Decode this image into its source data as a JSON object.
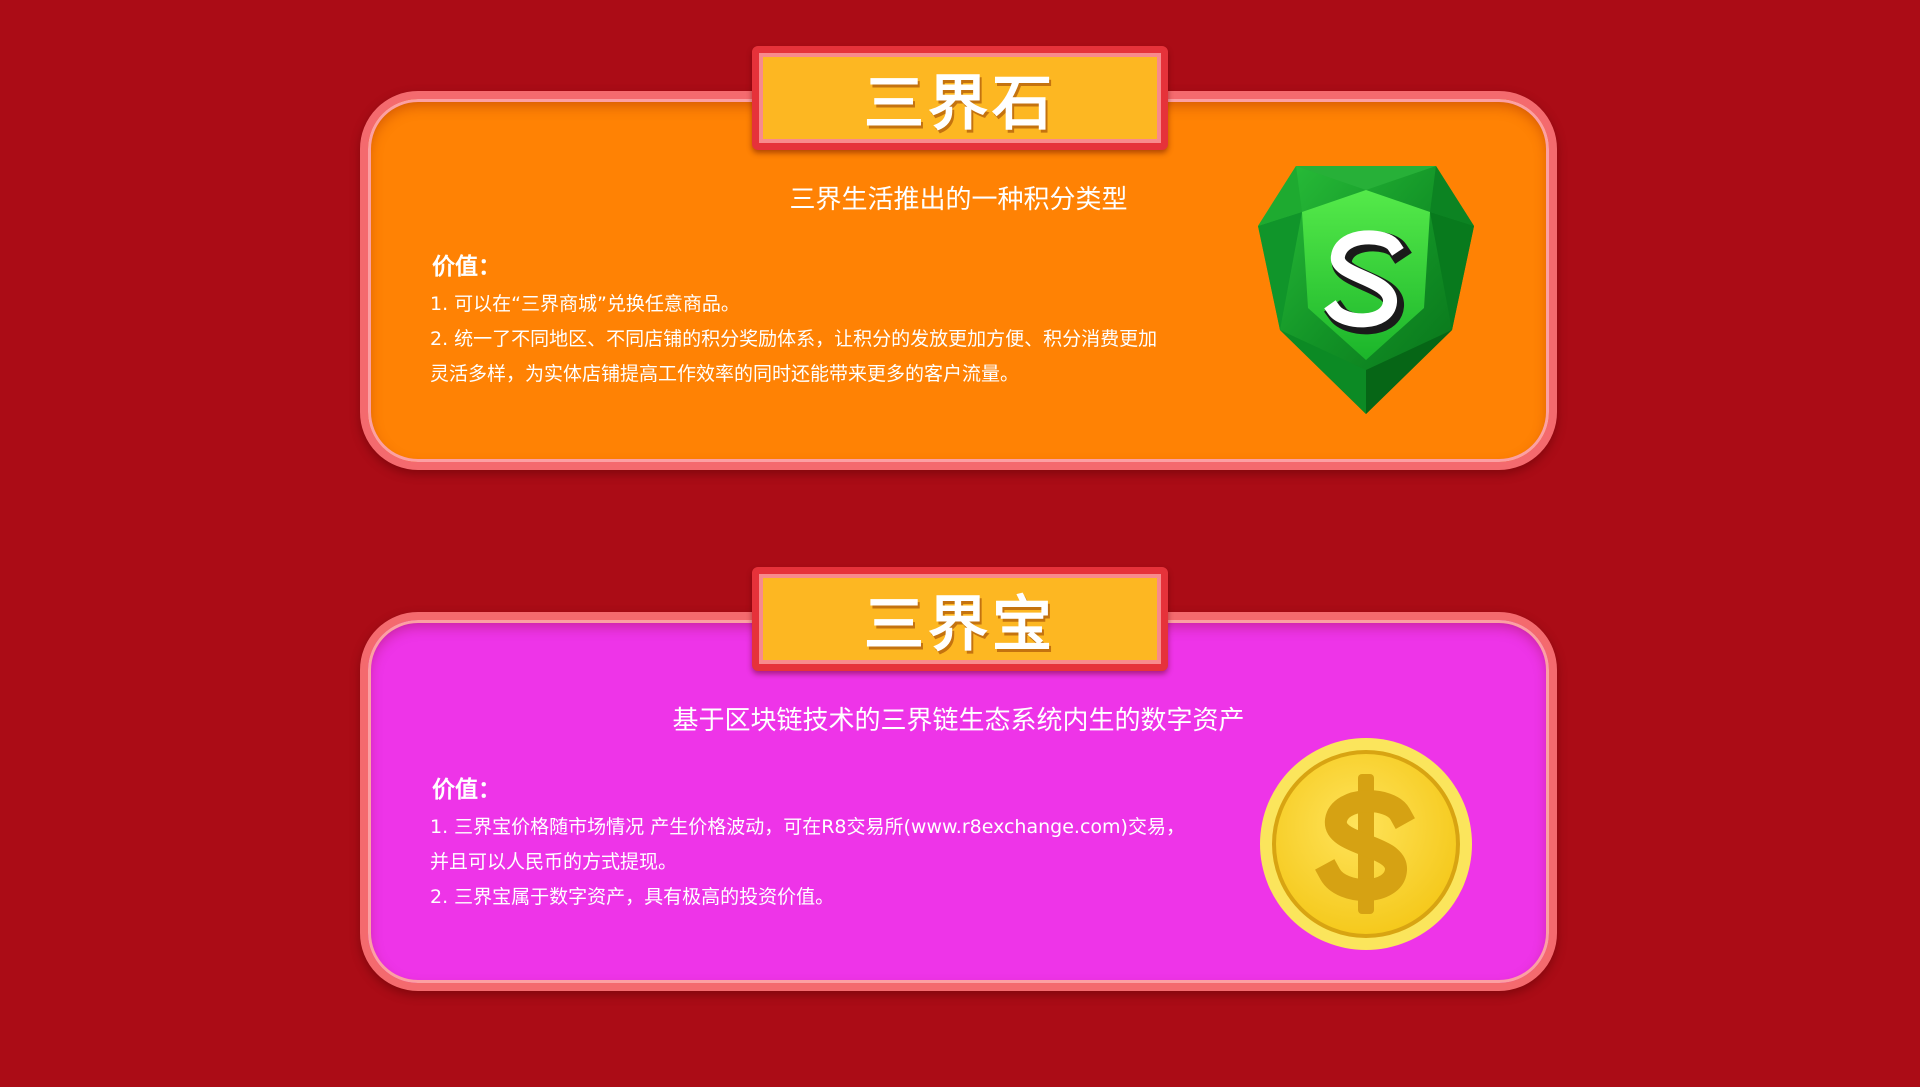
{
  "sections": [
    {
      "title": "三界石",
      "subtitle": "三界生活推出的一种积分类型",
      "value_label": "价值：",
      "lines": [
        "1. 可以在“三界商城”兑换任意商品。",
        "2. 统一了不同地区、不同店铺的积分奖励体系，让积分的发放更加方便、积分消费更加",
        "灵活多样，为实体店铺提高工作效率的同时还能带来更多的客户流量。"
      ],
      "icon": "green-gem-shield-icon",
      "background_color": "#ff8204"
    },
    {
      "title": "三界宝",
      "subtitle": "基于区块链技术的三界链生态系统内生的数字资产",
      "value_label": "价值：",
      "lines": [
        "1. 三界宝价格随市场情况 产生价格波动，可在R8交易所(www.r8exchange.com)交易，",
        "并且可以人民币的方式提现。",
        "2. 三界宝属于数字资产，具有极高的投资价值。"
      ],
      "icon": "gold-dollar-coin-icon",
      "background_color": "#ee34e8"
    }
  ],
  "colors": {
    "page_background": "#ab0c16",
    "tab_background": "#fdb722",
    "border": "#f46a6e"
  }
}
